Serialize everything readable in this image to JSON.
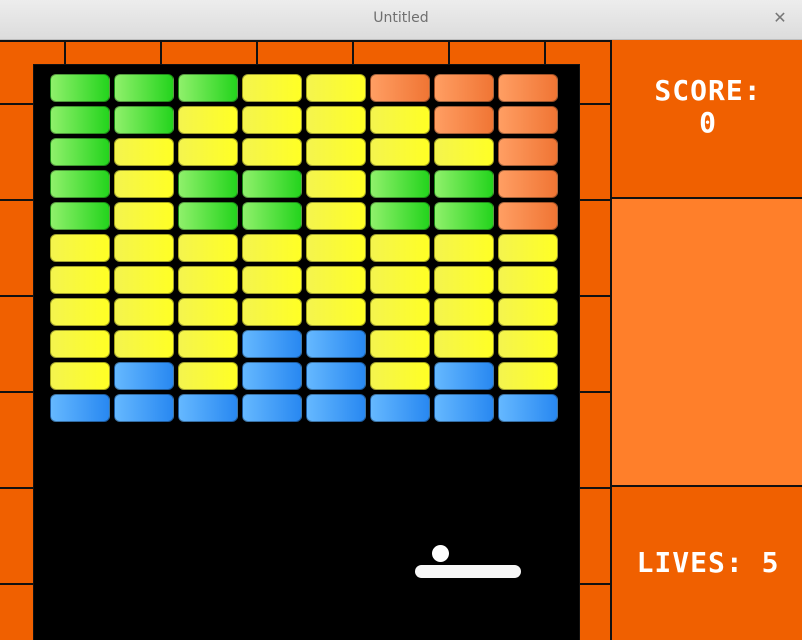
{
  "window": {
    "title": "Untitled",
    "close_icon": "close-icon"
  },
  "colors": {
    "window_background": "#f06000",
    "playfield_background": "#000000",
    "sidebar_middle": "#ff7f2a",
    "wall_lines": "#111111",
    "text": "#ffffff"
  },
  "scoreboard": {
    "score_label": "SCORE:",
    "score_value": "0",
    "lives_text": "LIVES: 5"
  },
  "bricks": [
    [
      "green",
      "green",
      "green",
      "yellow",
      "yellow",
      "orange",
      "orange",
      "orange"
    ],
    [
      "green",
      "green",
      "yellow",
      "yellow",
      "yellow",
      "yellow",
      "orange",
      "orange"
    ],
    [
      "green",
      "yellow",
      "yellow",
      "yellow",
      "yellow",
      "yellow",
      "yellow",
      "orange"
    ],
    [
      "green",
      "yellow",
      "green",
      "green",
      "yellow",
      "green",
      "green",
      "orange"
    ],
    [
      "green",
      "yellow",
      "green",
      "green",
      "yellow",
      "green",
      "green",
      "orange"
    ],
    [
      "yellow",
      "yellow",
      "yellow",
      "yellow",
      "yellow",
      "yellow",
      "yellow",
      "yellow"
    ],
    [
      "yellow",
      "yellow",
      "yellow",
      "yellow",
      "yellow",
      "yellow",
      "yellow",
      "yellow"
    ],
    [
      "yellow",
      "yellow",
      "yellow",
      "yellow",
      "yellow",
      "yellow",
      "yellow",
      "yellow"
    ],
    [
      "yellow",
      "yellow",
      "yellow",
      "blue",
      "blue",
      "yellow",
      "yellow",
      "yellow"
    ],
    [
      "yellow",
      "blue",
      "yellow",
      "blue",
      "blue",
      "yellow",
      "blue",
      "yellow"
    ],
    [
      "blue",
      "blue",
      "blue",
      "blue",
      "blue",
      "blue",
      "blue",
      "blue"
    ]
  ]
}
